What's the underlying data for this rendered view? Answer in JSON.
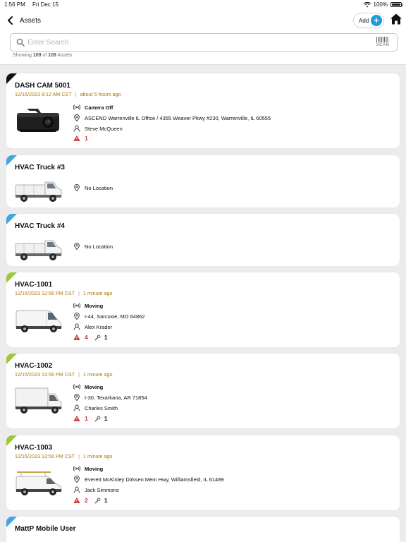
{
  "status_bar": {
    "time": "1:56 PM",
    "date": "Fri Dec 15",
    "battery": "100%"
  },
  "nav": {
    "title": "Assets",
    "add_label": "Add"
  },
  "search": {
    "placeholder": "Enter Search",
    "scan_label": "SCAN"
  },
  "showing": {
    "prefix": "Showing",
    "shown": "109",
    "of": "of",
    "total": "109",
    "suffix": "Assets"
  },
  "colors": {
    "accent": "#1b9be0",
    "timeline": "#b07800",
    "alert": "#d0312d",
    "corner_black": "#111111",
    "corner_blue": "#3fa7e0",
    "corner_green": "#9cc83a"
  },
  "assets": [
    {
      "name": "DASH CAM 5001",
      "timestamp": "12/15/2023 8:12 AM CST",
      "ago": "about 5 hours ago",
      "status": "Camera Off",
      "location": "ASCEND Warrenville IL Office / 4355 Weaver Pkwy #230, Warrenville, IL 60555",
      "driver": "Steve McQueen",
      "alerts": "1",
      "maintenance": "",
      "icon": "dashcam-image",
      "corner": "black"
    },
    {
      "name": "HVAC Truck #3",
      "location": "No Location",
      "icon": "service-truck-image",
      "corner": "blue"
    },
    {
      "name": "HVAC Truck #4",
      "location": "No Location",
      "icon": "service-truck-image",
      "corner": "blue"
    },
    {
      "name": "HVAC-1001",
      "timestamp": "12/15/2023 12:56 PM CST",
      "ago": "1 minute ago",
      "status": "Moving",
      "location": "I-44, Sarcoxie, MO 64862",
      "driver": "Alex Krader",
      "alerts": "4",
      "maintenance": "1",
      "icon": "cargo-van-image",
      "corner": "green"
    },
    {
      "name": "HVAC-1002",
      "timestamp": "12/15/2023 12:56 PM CST",
      "ago": "1 minute ago",
      "status": "Moving",
      "location": "I-30, Texarkana, AR 71854",
      "driver": "Charles Smith",
      "alerts": "1",
      "maintenance": "1",
      "icon": "box-truck-image",
      "corner": "green"
    },
    {
      "name": "HVAC-1003",
      "timestamp": "12/15/2023 12:56 PM CST",
      "ago": "1 minute ago",
      "status": "Moving",
      "location": "Everett McKinley Dirksen Mem Hwy, Williamsfield, IL 61489",
      "driver": "Jack Simmons",
      "alerts": "2",
      "maintenance": "1",
      "icon": "work-van-image",
      "corner": "green"
    },
    {
      "name": "MattP Mobile User",
      "corner": "blue"
    }
  ]
}
